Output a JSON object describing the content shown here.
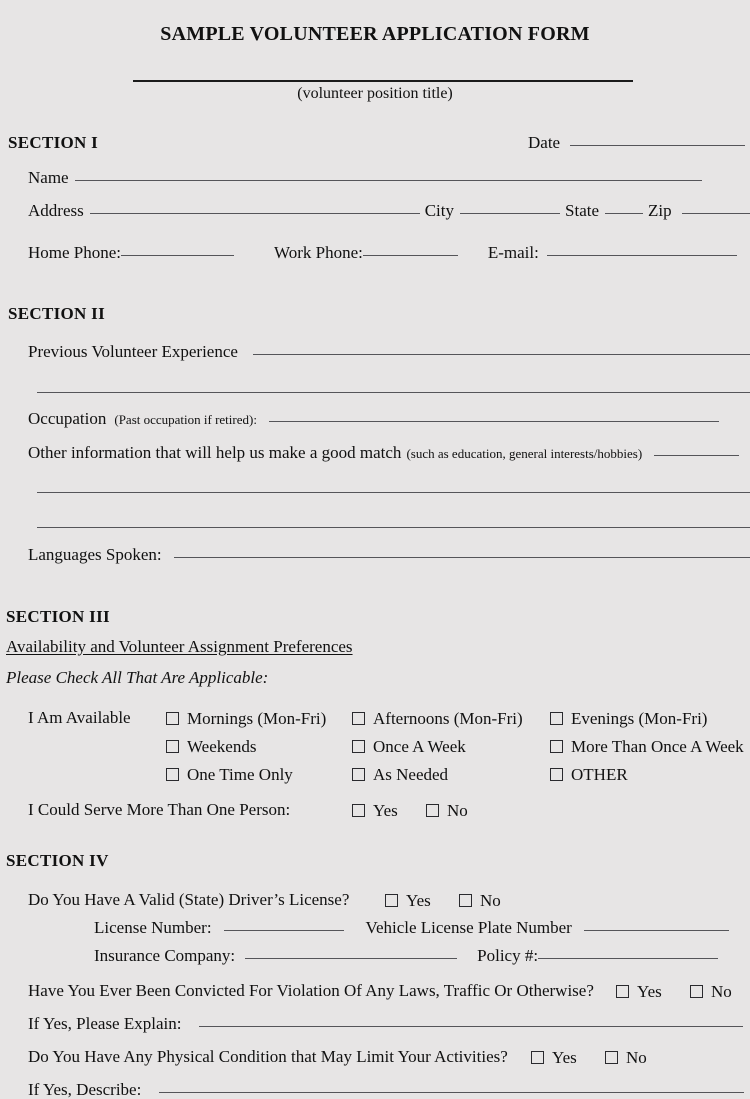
{
  "document": {
    "title": "SAMPLE VOLUNTEER APPLICATION FORM",
    "position_title_caption": "(volunteer position title)"
  },
  "section1": {
    "heading": "SECTION  I",
    "date_label": "Date",
    "name_label": "Name",
    "address_label": "Address",
    "city_label": "City",
    "state_label": "State",
    "zip_label": "Zip",
    "home_phone_label": "Home Phone:",
    "work_phone_label": "Work Phone:",
    "email_label": "E-mail:"
  },
  "section2": {
    "heading": "SECTION  II",
    "previous_experience_label": "Previous Volunteer Experience",
    "occupation_label": "Occupation",
    "occupation_note": "(Past occupation if retired):",
    "other_info_label": "Other information that will help us make a good match",
    "other_info_note": "(such as education, general interests/hobbies)",
    "languages_label": "Languages Spoken:"
  },
  "section3": {
    "heading": "SECTION  III",
    "subheading": "Availability and Volunteer Assignment Preferences",
    "instruction": "Please Check All That Are Applicable:",
    "available_label": "I Am Available",
    "options": [
      "Mornings (Mon-Fri)",
      "Afternoons (Mon-Fri)",
      "Evenings (Mon-Fri)",
      "Weekends",
      "Once A Week",
      "More Than Once A Week",
      "One Time Only",
      "As Needed",
      "OTHER"
    ],
    "serve_more_label": "I Could Serve More Than One Person:",
    "serve_more_yes": "Yes",
    "serve_more_no": "No"
  },
  "section4": {
    "heading": "SECTION  IV",
    "license_question": "Do You Have A Valid  (State) Driver’s License?",
    "license_yes": "Yes",
    "license_no": "No",
    "license_number_label": "License Number:",
    "vehicle_plate_label": "Vehicle License Plate Number",
    "insurance_company_label": "Insurance Company:",
    "policy_label": "Policy #:",
    "convicted_question": "Have You Ever Been Convicted For Violation Of Any Laws, Traffic Or Otherwise?",
    "convicted_yes": "Yes",
    "convicted_no": "No",
    "if_yes_explain_label": "If Yes, Please Explain:",
    "physical_question": "Do You Have Any Physical Condition that May Limit Your Activities?",
    "physical_yes": "Yes",
    "physical_no": "No",
    "if_yes_describe_label": "If Yes, Describe:"
  },
  "theme": {
    "page_background": "#e7e5e5",
    "text_color": "#111111",
    "rule_color": "#555559",
    "title_rule_color": "#1b1b1b",
    "checkbox_border_color": "#2a2a2e"
  }
}
